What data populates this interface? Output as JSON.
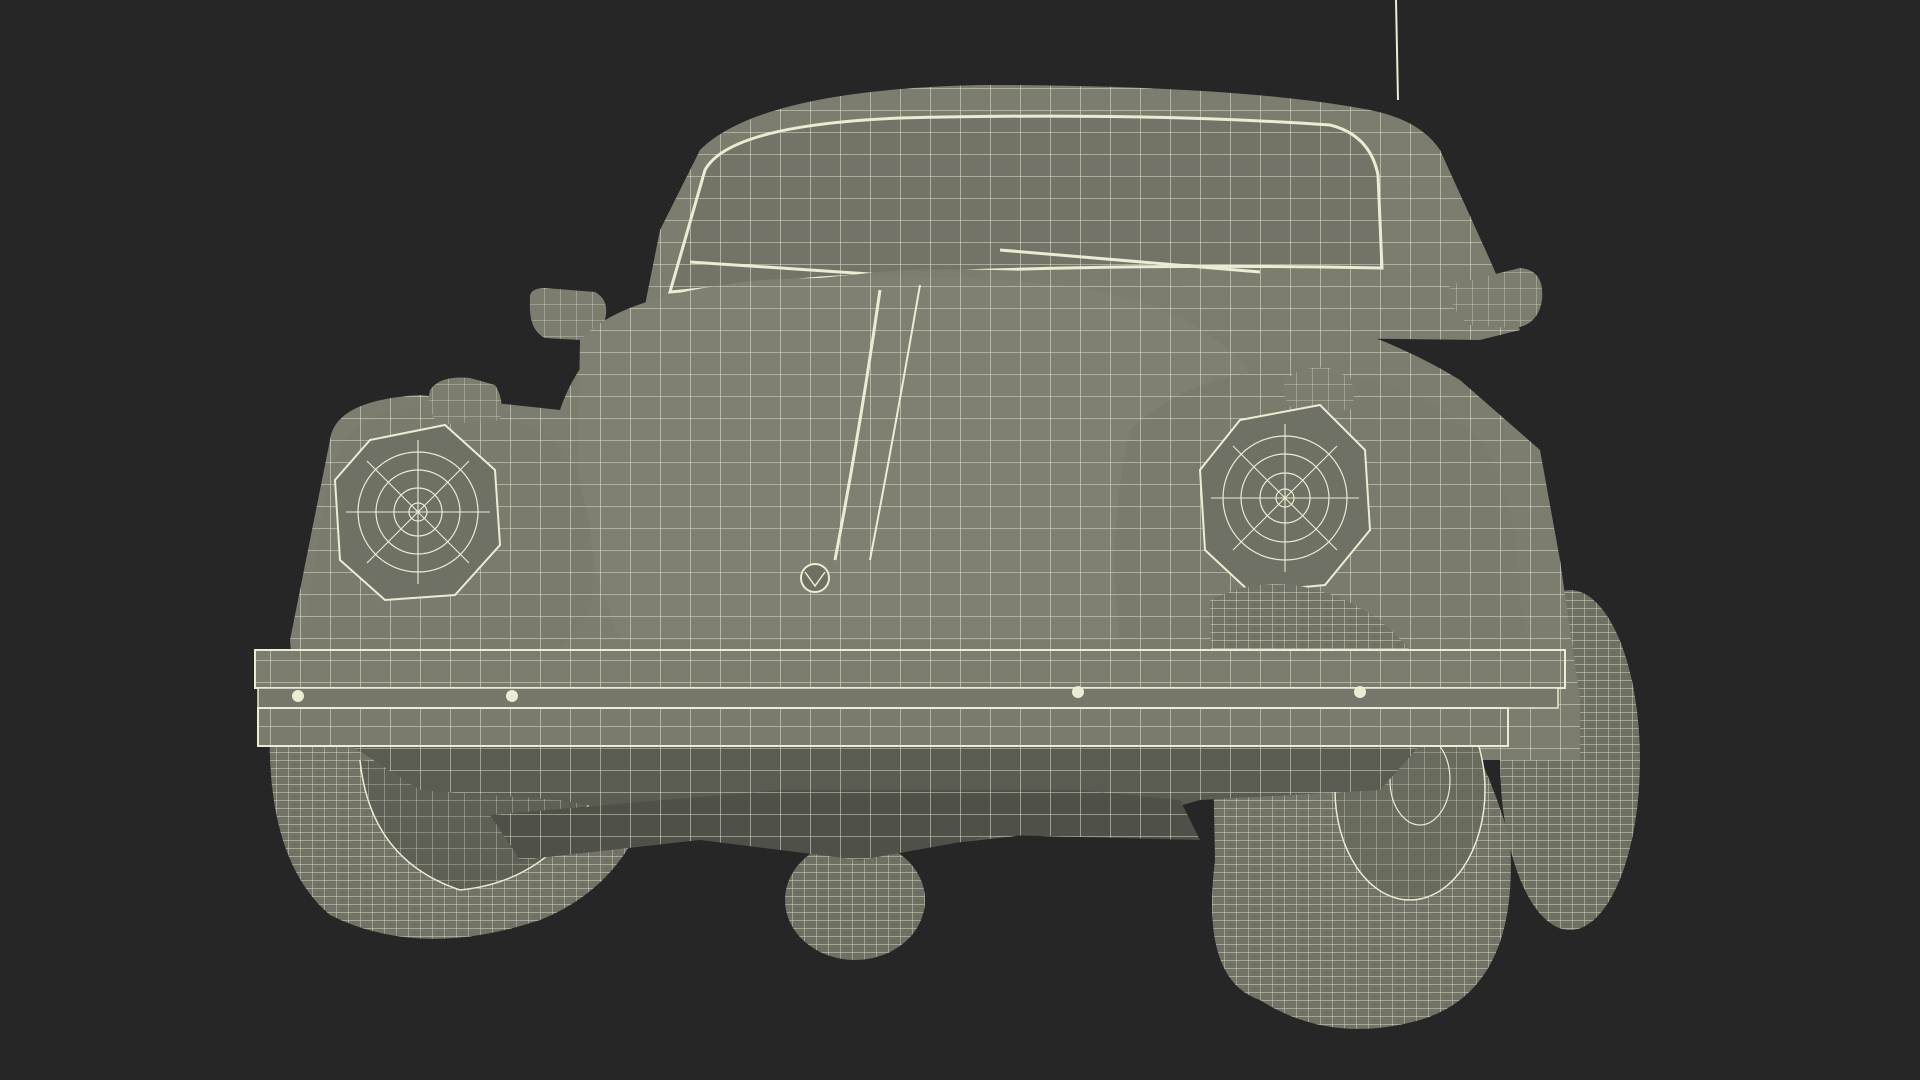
{
  "scene": {
    "background_color": "#262626",
    "body_color": "#7c7d6f",
    "body_shade_color": "#6a6b5f",
    "dark_underside_color": "#4f5047",
    "wire_color": "#ecebd3",
    "subject": "wireframe-render-of-a-classic-beetle-car-front-view"
  }
}
